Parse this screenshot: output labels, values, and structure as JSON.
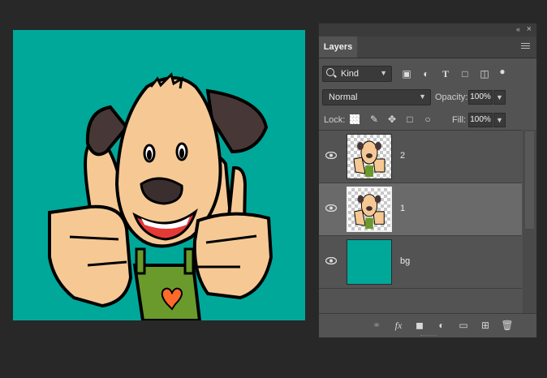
{
  "panel": {
    "collapse_glyph": "«",
    "close_glyph": "×",
    "tab_label": "Layers"
  },
  "filter": {
    "kind_label": "Kind",
    "icons": [
      "image-filter-icon",
      "adjustment-filter-icon",
      "type-filter-icon",
      "shape-filter-icon",
      "smart-object-filter-icon",
      "filter-toggle-icon"
    ]
  },
  "blend": {
    "mode": "Normal",
    "opacity_label": "Opacity:",
    "opacity_value": "100%"
  },
  "lock": {
    "label": "Lock:",
    "fill_label": "Fill:",
    "fill_value": "100%"
  },
  "layers": [
    {
      "name": "2",
      "selected": false,
      "visible": true,
      "thumb": "transparent-dog"
    },
    {
      "name": "1",
      "selected": true,
      "visible": true,
      "thumb": "transparent-dog"
    },
    {
      "name": "bg",
      "selected": false,
      "visible": true,
      "thumb": "solid-fill"
    }
  ],
  "colors": {
    "canvas_bg": "#00a89a",
    "panel_bg": "#535353",
    "selected_row": "#6a6a6a",
    "app_bg": "#282828"
  },
  "footer_icons": [
    "link-layers-icon",
    "fx-icon",
    "mask-icon",
    "adjustment-layer-icon",
    "new-group-icon",
    "new-layer-icon",
    "delete-icon"
  ]
}
